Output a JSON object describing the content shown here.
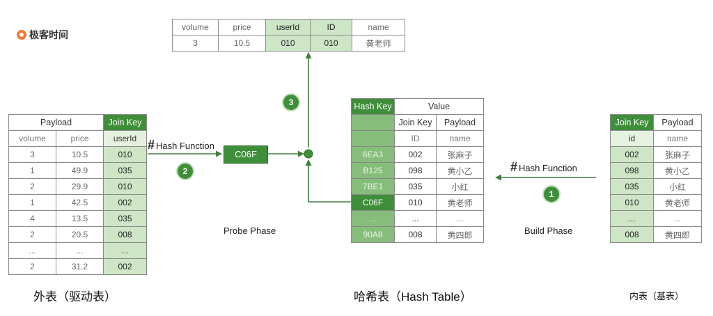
{
  "logo": {
    "text": "极客时间"
  },
  "left_table": {
    "group_headers": [
      "Payload",
      "Join Key"
    ],
    "columns": [
      "volume",
      "price",
      "userId"
    ],
    "rows": [
      [
        "3",
        "10.5",
        "010"
      ],
      [
        "1",
        "49.9",
        "035"
      ],
      [
        "2",
        "29.9",
        "010"
      ],
      [
        "1",
        "42.5",
        "002"
      ],
      [
        "4",
        "13.5",
        "035"
      ],
      [
        "2",
        "20.5",
        "008"
      ],
      [
        "...",
        "...",
        "..."
      ],
      [
        "2",
        "31.2",
        "002"
      ]
    ]
  },
  "top_table": {
    "columns": [
      "volume",
      "price",
      "userId",
      "ID",
      "name"
    ],
    "row": [
      "3",
      "10.5",
      "010",
      "010",
      "黄老师"
    ]
  },
  "hash_table": {
    "header": [
      "Hash Key",
      "Value"
    ],
    "sub_header": [
      "Join Key",
      "Payload"
    ],
    "sub_sub_header": [
      "ID",
      "name"
    ],
    "rows": [
      [
        "6EA3",
        "002",
        "张麻子"
      ],
      [
        "B125",
        "098",
        "黄小乙"
      ],
      [
        "7BE1",
        "035",
        "小红"
      ],
      [
        "C06F",
        "010",
        "黄老师"
      ],
      [
        "...",
        "...",
        "..."
      ],
      [
        "90A8",
        "008",
        "黄四郎"
      ]
    ]
  },
  "right_table": {
    "header": [
      "Join Key",
      "Payload"
    ],
    "columns": [
      "id",
      "name"
    ],
    "rows": [
      [
        "002",
        "张麻子"
      ],
      [
        "098",
        "黄小乙"
      ],
      [
        "035",
        "小红"
      ],
      [
        "010",
        "黄老师"
      ],
      [
        "...",
        "..."
      ],
      [
        "008",
        "黄四郎"
      ]
    ]
  },
  "labels": {
    "hash_function_left": "Hash Function",
    "hash_function_right": "Hash Function",
    "hash_symbol": "#",
    "hash_value": "C06F",
    "probe_phase": "Probe Phase",
    "build_phase": "Build Phase"
  },
  "steps": [
    "1",
    "2",
    "3"
  ],
  "captions": {
    "outer": "外表（驱动表）",
    "hash_table": "哈希表（Hash Table）",
    "inner": "内表（基表）"
  },
  "colors": {
    "green_dark": "#3f8f3a",
    "green_mid": "#86bd7a",
    "green_light": "#cfe6c6",
    "arrow": "#3f7f3a"
  }
}
